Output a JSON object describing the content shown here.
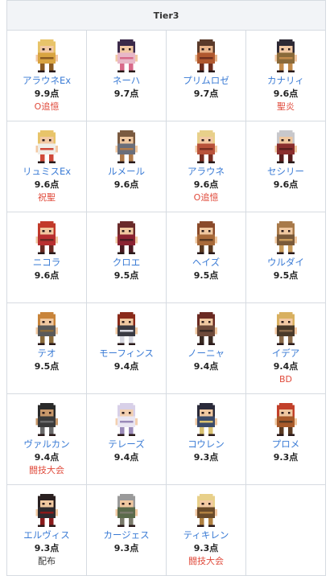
{
  "header": {
    "title": "Tier3"
  },
  "score_suffix": "点",
  "colors": {
    "name": "#3a7bd5",
    "tag": "#e04b3c",
    "header_bg": "#f2f4f7",
    "border": "#d6dbe1"
  },
  "characters": [
    {
      "name": "アラウネEx",
      "score": "9.9点",
      "tag": "O追憶",
      "tag_color": "red",
      "palette": {
        "hair": "#e8c46a",
        "skin": "#f3c9a4",
        "body": "#d9a441",
        "accent": "#8a5a22"
      }
    },
    {
      "name": "ネーハ",
      "score": "9.7点",
      "tag": "",
      "palette": {
        "hair": "#3b2a4a",
        "skin": "#f3c9a4",
        "body": "#e8b8c8",
        "accent": "#d86a8a"
      }
    },
    {
      "name": "プリムロゼ",
      "score": "9.7点",
      "tag": "",
      "palette": {
        "hair": "#5a3a2a",
        "skin": "#e8b48a",
        "body": "#b0582e",
        "accent": "#6e2e1e"
      }
    },
    {
      "name": "カナリィ",
      "score": "9.6点",
      "tag": "聖炎",
      "tag_color": "red",
      "palette": {
        "hair": "#2e2a35",
        "skin": "#f3c9a4",
        "body": "#8a6a3a",
        "accent": "#c28a4a"
      }
    },
    {
      "name": "リュミスEx",
      "score": "9.6点",
      "tag": "祝聖",
      "tag_color": "red",
      "palette": {
        "hair": "#e8c46a",
        "skin": "#f3c9a4",
        "body": "#f0eee8",
        "accent": "#d04a3a"
      }
    },
    {
      "name": "ルメール",
      "score": "9.6点",
      "tag": "",
      "palette": {
        "hair": "#7a5a40",
        "skin": "#f0c8a0",
        "body": "#6a6e7a",
        "accent": "#b07a4a"
      }
    },
    {
      "name": "アラウネ",
      "score": "9.6点",
      "tag": "O追憶",
      "tag_color": "red",
      "palette": {
        "hair": "#e8d08a",
        "skin": "#f3c9a4",
        "body": "#b8523a",
        "accent": "#7a2e22"
      }
    },
    {
      "name": "セシリー",
      "score": "9.6点",
      "tag": "",
      "palette": {
        "hair": "#c8c8cc",
        "skin": "#f0c8a0",
        "body": "#8a2e2e",
        "accent": "#5a1e1e"
      }
    },
    {
      "name": "ニコラ",
      "score": "9.6点",
      "tag": "",
      "palette": {
        "hair": "#c23a2a",
        "skin": "#f0c8a0",
        "body": "#b83030",
        "accent": "#6a2a22"
      }
    },
    {
      "name": "クロエ",
      "score": "9.5点",
      "tag": "",
      "palette": {
        "hair": "#6a2a2a",
        "skin": "#f0c8a0",
        "body": "#8a2232",
        "accent": "#4a1a22"
      }
    },
    {
      "name": "ヘイズ",
      "score": "9.5点",
      "tag": "",
      "palette": {
        "hair": "#8a4a2a",
        "skin": "#f0c8a0",
        "body": "#a86a3a",
        "accent": "#5a3a22"
      }
    },
    {
      "name": "ウルダイ",
      "score": "9.5点",
      "tag": "",
      "palette": {
        "hair": "#a87a4a",
        "skin": "#f0c8a0",
        "body": "#7a5a3a",
        "accent": "#c89a5a"
      }
    },
    {
      "name": "テオ",
      "score": "9.5点",
      "tag": "",
      "palette": {
        "hair": "#c8843a",
        "skin": "#f0c8a0",
        "body": "#5a5a5a",
        "accent": "#8a6a3a"
      }
    },
    {
      "name": "モーフィンス",
      "score": "9.4点",
      "tag": "",
      "palette": {
        "hair": "#8a2a1a",
        "skin": "#f0c8a0",
        "body": "#3a3a42",
        "accent": "#d8d8e0"
      }
    },
    {
      "name": "ノーニャ",
      "score": "9.4点",
      "tag": "",
      "palette": {
        "hair": "#6a2a22",
        "skin": "#f0c8a0",
        "body": "#6e4a3a",
        "accent": "#3a2a22"
      }
    },
    {
      "name": "イデア",
      "score": "9.4点",
      "tag": "BD",
      "tag_color": "red",
      "palette": {
        "hair": "#d8b060",
        "skin": "#f3c9a4",
        "body": "#4a3a2a",
        "accent": "#8a6a4a"
      }
    },
    {
      "name": "ヴァルカン",
      "score": "9.4点",
      "tag": "闘技大会",
      "tag_color": "red",
      "palette": {
        "hair": "#2a2a2a",
        "skin": "#c8986a",
        "body": "#3a3a3a",
        "accent": "#6a6a6a"
      }
    },
    {
      "name": "テレーズ",
      "score": "9.4点",
      "tag": "",
      "palette": {
        "hair": "#d8d0e8",
        "skin": "#f3d0b0",
        "body": "#eae6f2",
        "accent": "#9a8ab8"
      }
    },
    {
      "name": "コウレン",
      "score": "9.3点",
      "tag": "",
      "palette": {
        "hair": "#2a2a3a",
        "skin": "#f0c8a0",
        "body": "#3a4a6a",
        "accent": "#d8c070"
      }
    },
    {
      "name": "プロメ",
      "score": "9.3点",
      "tag": "",
      "palette": {
        "hair": "#c2402a",
        "skin": "#f0c8a0",
        "body": "#a85a2a",
        "accent": "#5a3a22"
      }
    },
    {
      "name": "エルヴィス",
      "score": "9.3点",
      "tag": "配布",
      "tag_color": "plain",
      "palette": {
        "hair": "#2a2020",
        "skin": "#f0c8a0",
        "body": "#2e2a2e",
        "accent": "#8a1a1a"
      }
    },
    {
      "name": "カージェス",
      "score": "9.3点",
      "tag": "",
      "palette": {
        "hair": "#9a9a9a",
        "skin": "#f0c8a0",
        "body": "#5a6a4a",
        "accent": "#7a7a6a"
      }
    },
    {
      "name": "ティキレン",
      "score": "9.3点",
      "tag": "闘技大会",
      "tag_color": "red",
      "palette": {
        "hair": "#e8d08a",
        "skin": "#f3c9a4",
        "body": "#6a4a2a",
        "accent": "#b08040"
      }
    }
  ]
}
